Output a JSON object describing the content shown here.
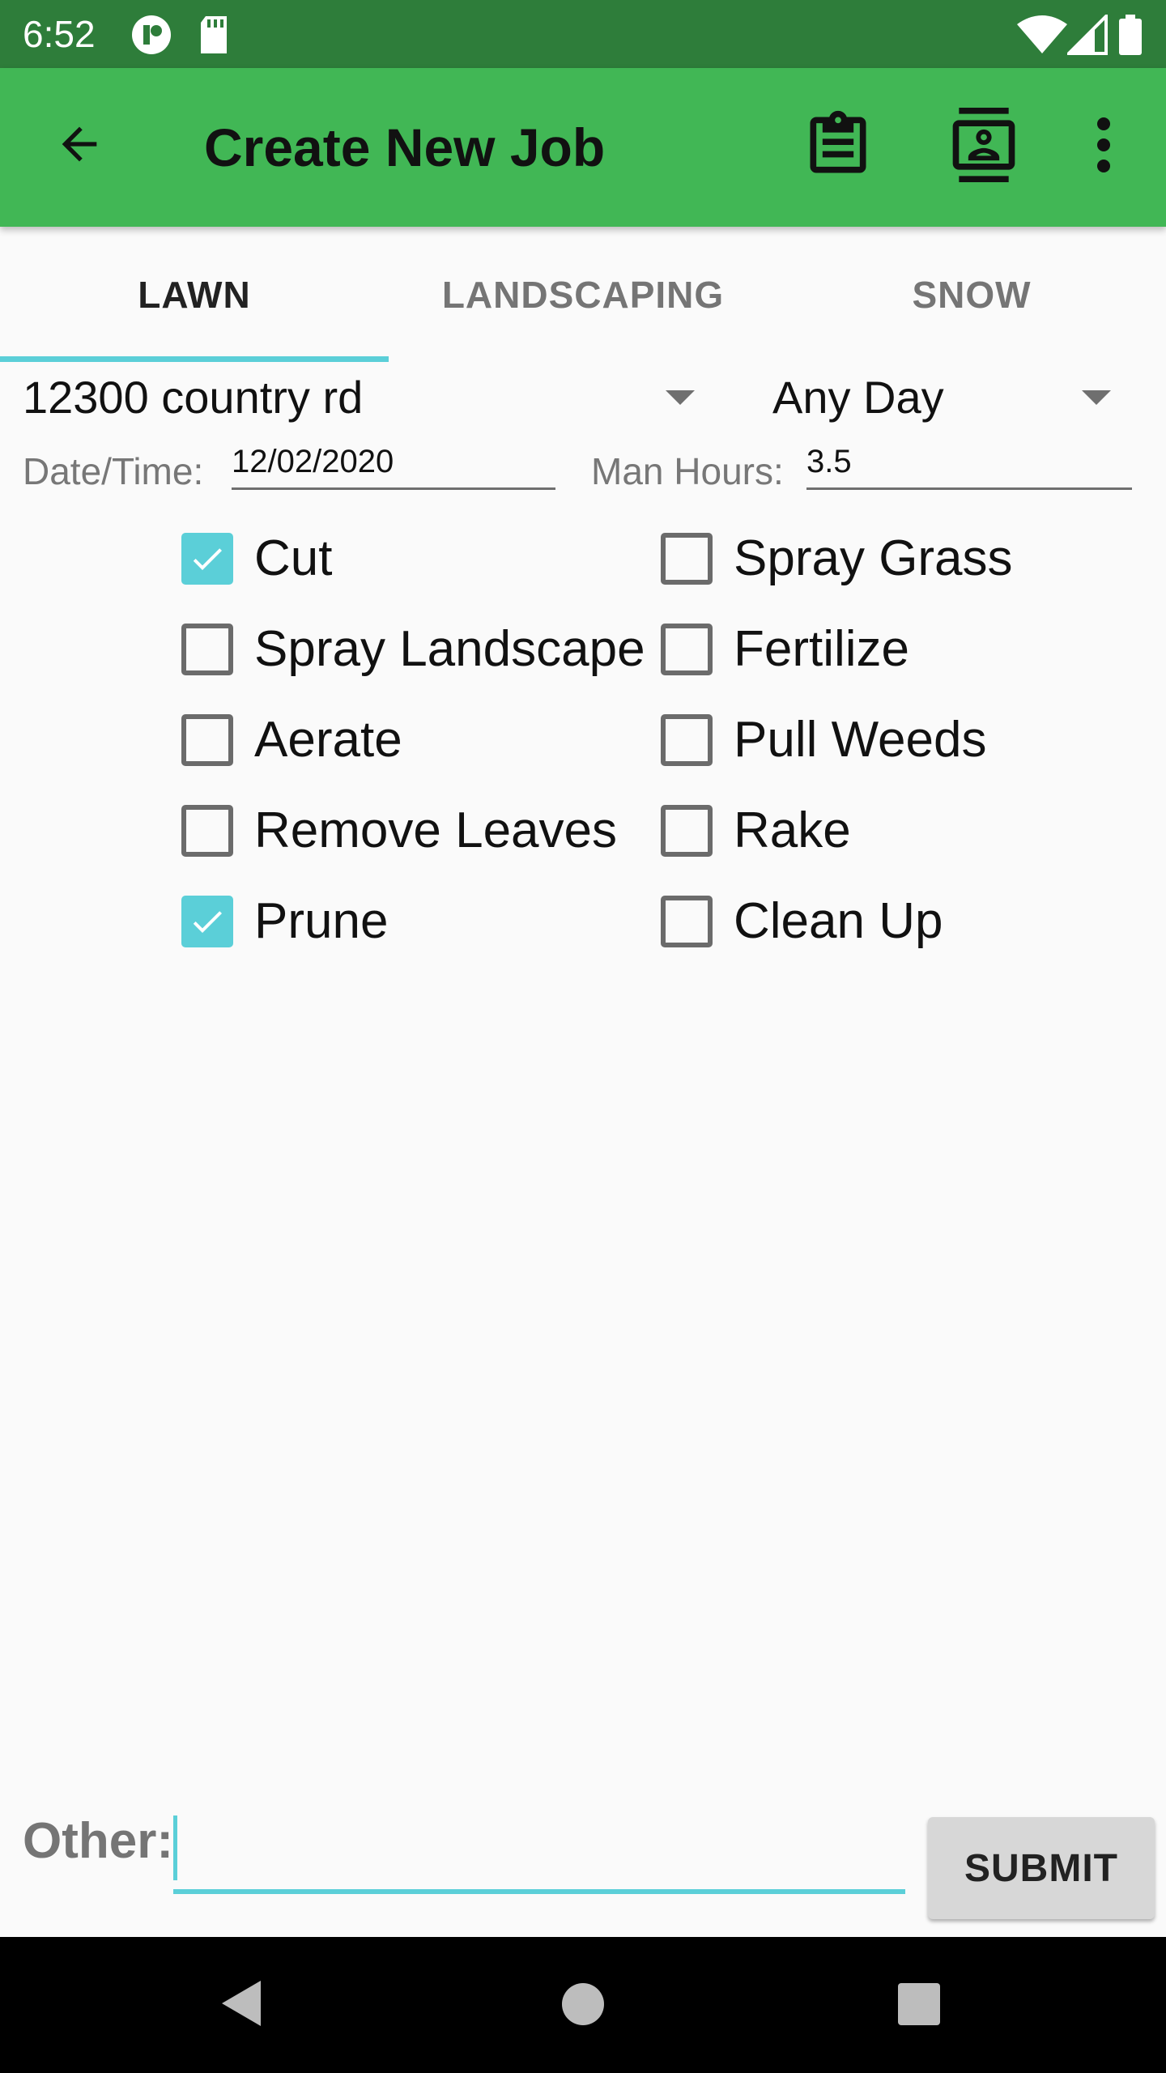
{
  "status_bar": {
    "time": "6:52",
    "icons": [
      "app-notification-icon",
      "sd-card-icon",
      "wifi-icon",
      "cell-signal-icon",
      "battery-icon"
    ]
  },
  "app_bar": {
    "title": "Create New Job",
    "actions": [
      "clipboard-icon",
      "contact-card-icon",
      "more-vert-icon"
    ],
    "color": "#41b755"
  },
  "tabs": [
    {
      "label": "LAWN",
      "selected": true
    },
    {
      "label": "LANDSCAPING",
      "selected": false
    },
    {
      "label": "SNOW",
      "selected": false
    }
  ],
  "form": {
    "address_selected": "12300 country rd",
    "day_selected": "Any Day",
    "date_label": "Date/Time:",
    "date_value": "12/02/2020",
    "hours_label": "Man Hours:",
    "hours_value": "3.5"
  },
  "services_left": [
    {
      "label": "Cut",
      "checked": true
    },
    {
      "label": "Spray Landscape",
      "checked": false
    },
    {
      "label": "Aerate",
      "checked": false
    },
    {
      "label": "Remove Leaves",
      "checked": false
    },
    {
      "label": "Prune",
      "checked": true
    }
  ],
  "services_right": [
    {
      "label": "Spray Grass",
      "checked": false
    },
    {
      "label": "Fertilize",
      "checked": false
    },
    {
      "label": "Pull Weeds",
      "checked": false
    },
    {
      "label": "Rake",
      "checked": false
    },
    {
      "label": "Clean Up",
      "checked": false
    }
  ],
  "other": {
    "label": "Other:",
    "value": ""
  },
  "submit_label": "SUBMIT",
  "accent_color": "#5bcfd8",
  "nav_bar": [
    "back-triangle-icon",
    "home-circle-icon",
    "recents-square-icon"
  ]
}
